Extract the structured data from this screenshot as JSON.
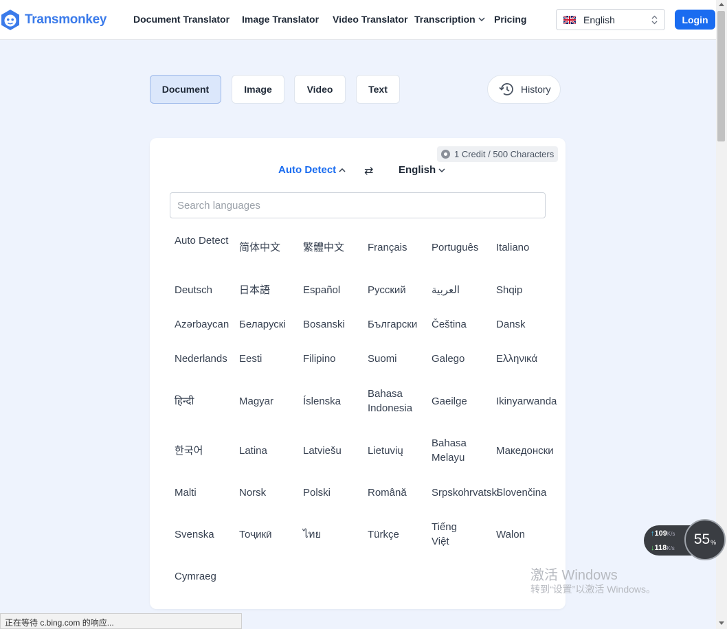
{
  "brand": {
    "name": "Transmonkey",
    "color": "#3b7bea"
  },
  "nav": [
    {
      "label": "Document Translator"
    },
    {
      "label": "Image Translator"
    },
    {
      "label": "Video Translator"
    },
    {
      "label": "Transcription"
    },
    {
      "label": "Pricing"
    }
  ],
  "ui_language": {
    "label": "English",
    "flag": "uk-flag-icon"
  },
  "login_label": "Login",
  "modes": [
    {
      "label": "Document",
      "active": true
    },
    {
      "label": "Image",
      "active": false
    },
    {
      "label": "Video",
      "active": false
    },
    {
      "label": "Text",
      "active": false
    }
  ],
  "history_label": "History",
  "credit_text": "1 Credit / 500 Characters",
  "source_language": "Auto Detect",
  "swap_glyph": "⇄",
  "target_language": "English",
  "search_placeholder": "Search languages",
  "languages": [
    "Auto Detect",
    "简体中文",
    "繁體中文",
    "Français",
    "Português",
    "Italiano",
    "Deutsch",
    "日本語",
    "Español",
    "Русский",
    "العربية",
    "Shqip",
    "Azərbaycan",
    "Беларускі",
    "Bosanski",
    "Български",
    "Čeština",
    "Dansk",
    "Nederlands",
    "Eesti",
    "Filipino",
    "Suomi",
    "Galego",
    "Ελληνικά",
    "हिन्दी",
    "Magyar",
    "Íslenska",
    "Bahasa Indonesia",
    "Gaeilge",
    "Ikinyarwanda",
    "한국어",
    "Latina",
    "Latviešu",
    "Lietuvių",
    "Bahasa Melayu",
    "Македонски",
    "Malti",
    "Norsk",
    "Polski",
    "Română",
    "Srpskohrvatski",
    "Slovenčina",
    "Svenska",
    "Тоҷикӣ",
    "ไทย",
    "Türkçe",
    "Tiếng Việt",
    "Walon",
    "Cymraeg"
  ],
  "network": {
    "up": "109",
    "down": "118",
    "unit": "K/s",
    "cpu": "55",
    "cpu_unit": "%"
  },
  "watermark": {
    "line1": "激活 Windows",
    "line2": "转到“设置”以激活 Windows。"
  },
  "status_text": "正在等待 c.bing.com 的响应..."
}
